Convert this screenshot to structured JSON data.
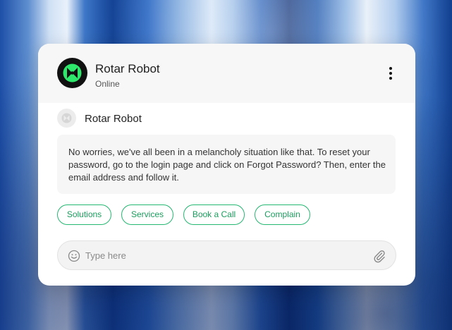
{
  "header": {
    "bot_name": "Rotar Robot",
    "status": "Online",
    "avatar_icon": "robot-logo-icon",
    "menu_icon": "more-vertical-icon"
  },
  "message": {
    "sender": "Rotar Robot",
    "text": "No worries, we've all been in a melancholy situation like that. To reset your password, go to the login page and click on Forgot Password? Then, enter the email address and follow it."
  },
  "quick_replies": [
    "Solutions",
    "Services",
    "Book a Call",
    "Complain"
  ],
  "composer": {
    "placeholder": "Type here",
    "emoji_icon": "smiley-icon",
    "attach_icon": "paperclip-icon"
  },
  "colors": {
    "accent": "#1a9d5d",
    "logo_green": "#2ee86b"
  }
}
